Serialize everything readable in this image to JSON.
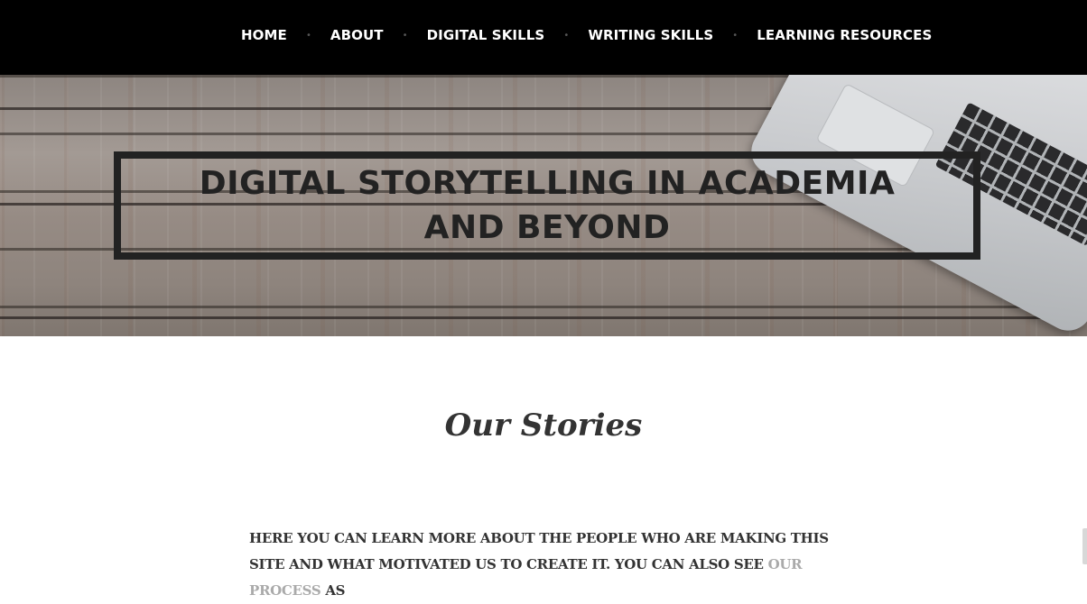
{
  "nav": {
    "items": [
      {
        "label": "HOME"
      },
      {
        "label": "ABOUT"
      },
      {
        "label": "DIGITAL SKILLS"
      },
      {
        "label": "WRITING SKILLS"
      },
      {
        "label": "LEARNING RESOURCES"
      }
    ],
    "separator": "•"
  },
  "hero": {
    "title": "DIGITAL STORYTELLING IN ACADEMIA AND BEYOND"
  },
  "main": {
    "section_title": "Our Stories",
    "intro_before_link": "HERE YOU CAN LEARN MORE ABOUT THE PEOPLE WHO ARE MAKING THIS SITE AND WHAT MOTIVATED US TO CREATE IT. YOU CAN ALSO SEE ",
    "intro_link": "OUR PROCESS",
    "intro_after_link": " AS"
  },
  "colors": {
    "nav_bg": "#000000",
    "nav_text": "#ffffff",
    "title_ink": "#222222",
    "body_text": "#333333",
    "link": "#aaaaaa"
  }
}
